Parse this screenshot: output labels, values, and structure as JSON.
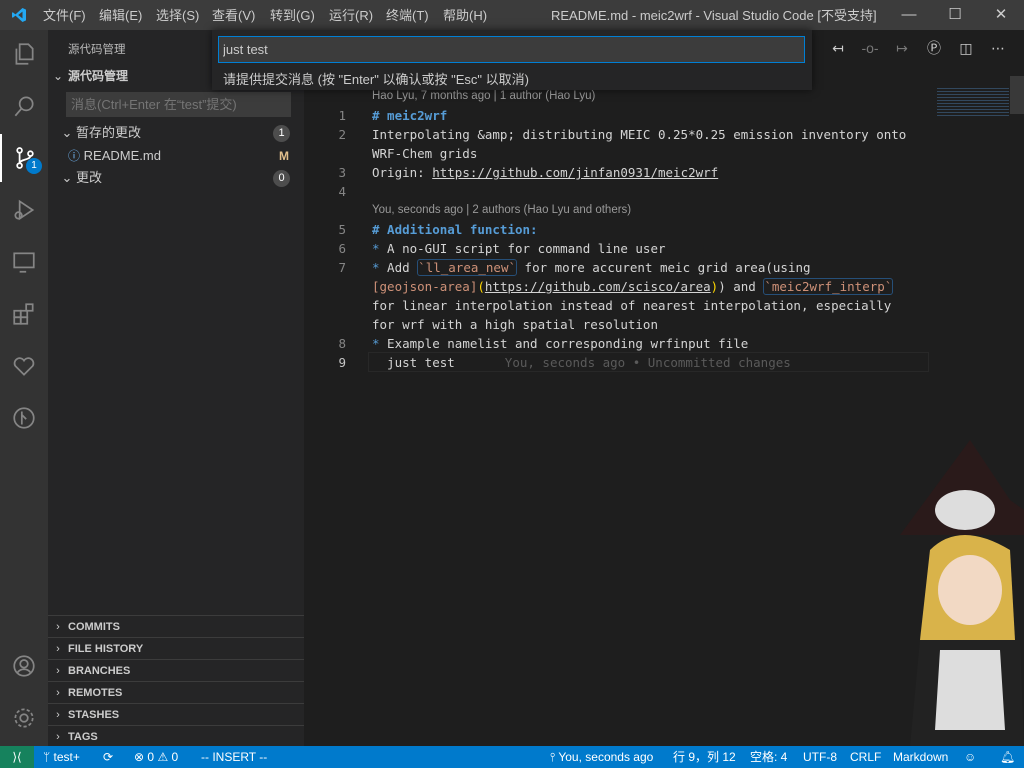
{
  "window": {
    "title": "README.md - meic2wrf - Visual Studio Code [不受支持]",
    "minimize": "—",
    "maximize": "☐",
    "close": "✕"
  },
  "menu": [
    "文件(F)",
    "编辑(E)",
    "选择(S)",
    "查看(V)",
    "转到(G)",
    "运行(R)",
    "终端(T)",
    "帮助(H)"
  ],
  "activity": {
    "scm_badge": "1"
  },
  "sidebar": {
    "title": "源代码管理",
    "section": "源代码管理",
    "message_placeholder": "消息(Ctrl+Enter 在“test”提交)",
    "staged": {
      "label": "暂存的更改",
      "count": "1",
      "files": [
        {
          "name": "README.md",
          "status": "M"
        }
      ]
    },
    "changes": {
      "label": "更改",
      "count": "0"
    },
    "panels": [
      "COMMITS",
      "FILE HISTORY",
      "BRANCHES",
      "REMOTES",
      "STASHES",
      "TAGS"
    ]
  },
  "quick_input": {
    "value": "just test",
    "message": "请提供提交消息 (按 \"Enter\" 以确认或按 \"Esc\" 以取消)"
  },
  "editor": {
    "lens1": "Hao Lyu, 7 months ago | 1 author (Hao Lyu)",
    "lens2": "You, seconds ago | 2 authors (Hao Lyu and others)",
    "line_numbers": [
      "1",
      "2",
      "3",
      "4",
      "5",
      "6",
      "7",
      "8",
      "9"
    ],
    "l1": "# meic2wrf",
    "l2a": "Interpolating &amp; distributing MEIC 0.25*0.25 emission inventory onto",
    "l2b": "WRF-Chem grids",
    "l3_prefix": "Origin: ",
    "l3_url": "https://github.com/jinfan0931/meic2wrf",
    "l5": "# Additional function:",
    "bullet": "*",
    "l6": " A no-GUI script for command line user",
    "l7_a": " Add ",
    "l7_code1": "`ll_area_new`",
    "l7_b": " for more accurent meic grid area(using",
    "l7_link_text": "[geojson-area]",
    "l7_url": "https://github.com/scisco/area",
    "l7_c": ") and ",
    "l7_code2": "`meic2wrf_interp`",
    "l7_d": "for linear interpolation instead of nearest interpolation, especially",
    "l7_e": "for wrf with a high spatial resolution",
    "l8": " Example namelist and corresponding wrfinput file",
    "l9": "  just test",
    "l9_blame": "You, seconds ago • Uncommitted changes"
  },
  "status": {
    "branch": "test+",
    "errors": "0",
    "warnings": "0",
    "mode": "-- INSERT --",
    "blame": "You, seconds ago",
    "position": "行 9，列 12",
    "spaces": "空格: 4",
    "encoding": "UTF-8",
    "eol": "CRLF",
    "language": "Markdown"
  },
  "colors": {
    "accent": "#007acc",
    "remote": "#16825d",
    "heading": "#569cd6",
    "code": "#ce9178"
  }
}
